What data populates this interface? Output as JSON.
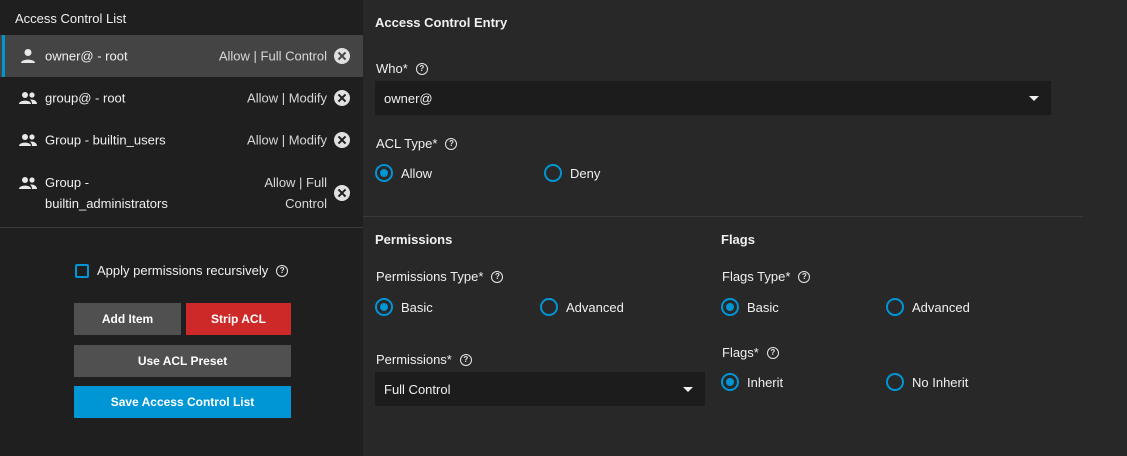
{
  "left": {
    "title": "Access Control List",
    "items": [
      {
        "who": "owner@ - root",
        "perm": "Allow | Full Control",
        "icon": "user-icon"
      },
      {
        "who": "group@ - root",
        "perm": "Allow | Modify",
        "icon": "group-icon"
      },
      {
        "who": "Group - builtin_users",
        "perm": "Allow | Modify",
        "icon": "group-icon"
      },
      {
        "who": "Group - builtin_administrators",
        "perm": "Allow | Full Control",
        "icon": "group-icon"
      }
    ],
    "recursive_label": "Apply permissions recursively",
    "buttons": {
      "add": "Add Item",
      "strip": "Strip ACL",
      "preset": "Use ACL Preset",
      "save": "Save Access Control List"
    }
  },
  "entry": {
    "title": "Access Control Entry",
    "who_label": "Who",
    "who_value": "owner@",
    "acl_type_label": "ACL Type",
    "acl_type_options": [
      "Allow",
      "Deny"
    ],
    "acl_type_selected": "Allow"
  },
  "permissions": {
    "title": "Permissions",
    "type_label": "Permissions Type",
    "type_options": [
      "Basic",
      "Advanced"
    ],
    "type_selected": "Basic",
    "perm_label": "Permissions",
    "perm_value": "Full Control"
  },
  "flags": {
    "title": "Flags",
    "type_label": "Flags Type",
    "type_options": [
      "Basic",
      "Advanced"
    ],
    "type_selected": "Basic",
    "flags_label": "Flags",
    "flags_options": [
      "Inherit",
      "No Inherit"
    ],
    "flags_selected": "Inherit"
  },
  "required_marker": "*",
  "help_glyph": "?",
  "colors": {
    "accent": "#0095d5",
    "danger": "#ce2929",
    "panel_bg": "#1f1f1f",
    "page_bg": "#282828"
  }
}
